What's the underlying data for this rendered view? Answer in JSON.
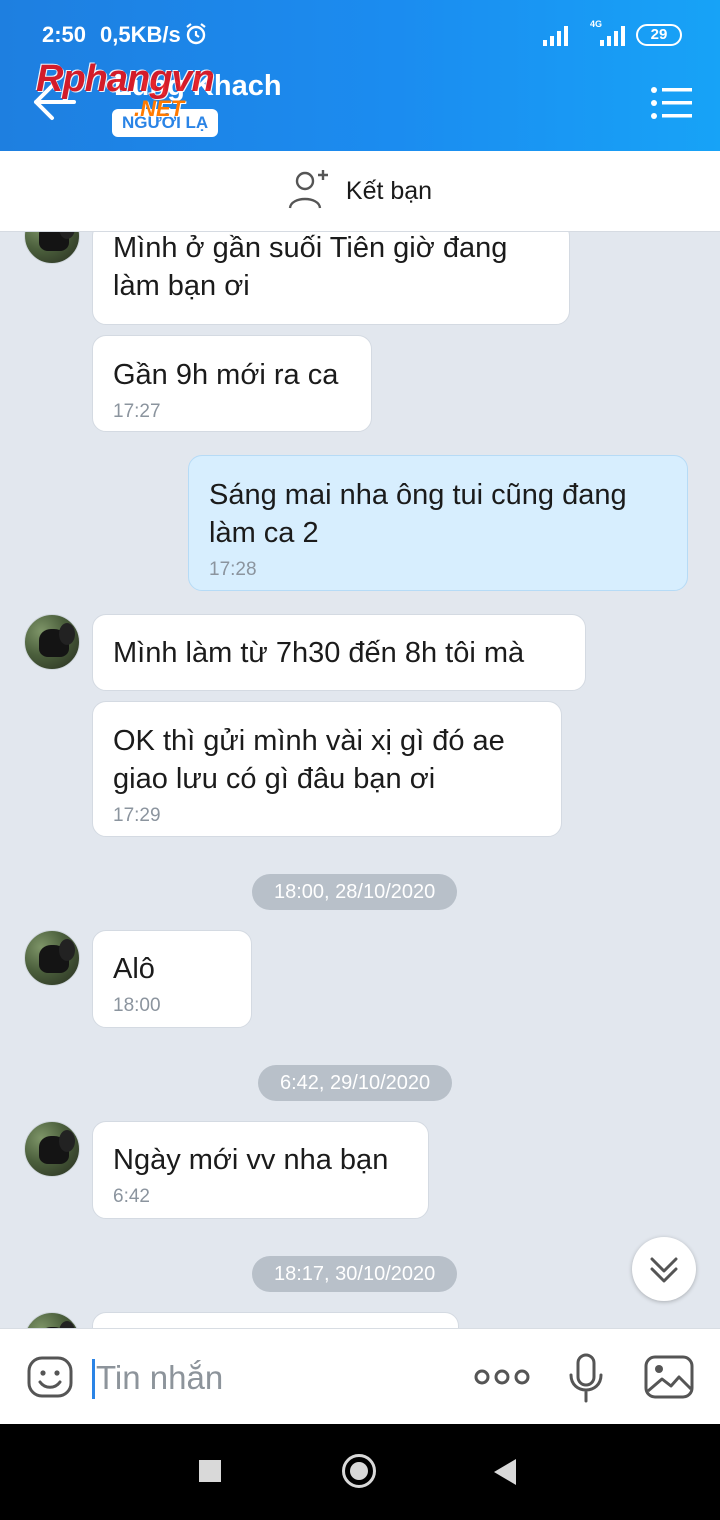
{
  "status_bar": {
    "time": "2:50",
    "network_speed": "0,5KB/s",
    "network_type": "4G",
    "battery": "29"
  },
  "header": {
    "chat_name": "Lung Khach",
    "badge": "NGƯỜI LẠ",
    "watermark": "Rphangvn",
    "watermark_sub": ".NET"
  },
  "add_friend": {
    "label": "Kết bạn"
  },
  "messages": [
    {
      "text": "Mình ở gần suối Tiên giờ đang làm bạn ơi",
      "time": ""
    },
    {
      "text": "Gần 9h mới ra ca",
      "time": "17:27"
    },
    {
      "text": "Sáng mai nha ông tui cũng đang làm ca 2",
      "time": "17:28"
    },
    {
      "text": "Mình làm từ 7h30 đến 8h tôi mà",
      "time": ""
    },
    {
      "text": "OK thì gửi mình vài xị gì đó ae giao lưu có gì đâu bạn ơi",
      "time": "17:29"
    },
    {
      "text": "Alô",
      "time": "18:00"
    },
    {
      "text": "Ngày mới vv nha bạn",
      "time": "6:42"
    }
  ],
  "timestamps": [
    "18:00, 28/10/2020",
    "6:42, 29/10/2020",
    "18:17, 30/10/2020"
  ],
  "input": {
    "placeholder": "Tin nhắn"
  },
  "colors": {
    "header_start": "#1e7fe0",
    "header_end": "#17a3f7",
    "mine_bubble": "#d7eefe",
    "chat_background": "#e2e7ee"
  }
}
